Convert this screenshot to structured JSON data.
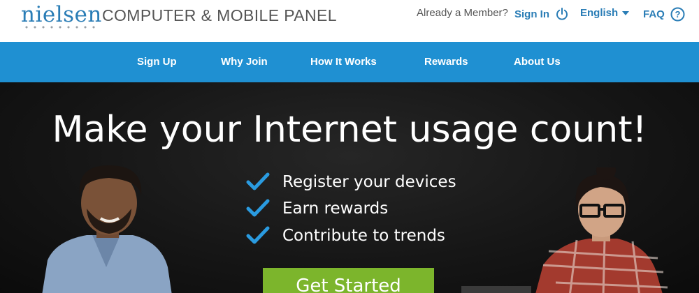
{
  "header": {
    "logo_text": "nielsen",
    "panel_title": "COMPUTER & MOBILE PANEL",
    "already_member": "Already a Member?",
    "sign_in": "Sign In",
    "language": "English",
    "faq": "FAQ"
  },
  "nav": {
    "items": [
      {
        "label": "Sign Up"
      },
      {
        "label": "Why Join"
      },
      {
        "label": "How It Works"
      },
      {
        "label": "Rewards"
      },
      {
        "label": "About Us"
      }
    ]
  },
  "hero": {
    "title": "Make your Internet usage count!",
    "bullets": [
      "Register your devices",
      "Earn rewards",
      "Contribute to trends"
    ],
    "cta": "Get Started"
  },
  "colors": {
    "brand_blue": "#1f90d2",
    "link_blue": "#2a7db6",
    "cta_green": "#7cb52c",
    "hero_bg": "#161616"
  },
  "icons": {
    "sign_in": "power-icon",
    "language": "caret-down-icon",
    "faq": "question-circle-icon",
    "bullet": "checkmark-icon"
  }
}
